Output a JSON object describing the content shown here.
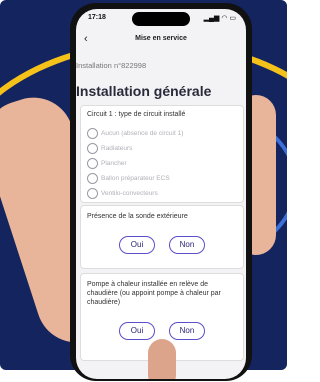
{
  "status_bar": {
    "time": "17:18"
  },
  "nav": {
    "back_icon": "chevron-left-icon",
    "title": "Mise en service"
  },
  "installation_number": "Installation n°822998",
  "page_title": "Installation générale",
  "circuit_card": {
    "title": "Circuit 1 : type de circuit installé",
    "options": [
      "Aucun (absence de circuit 1)",
      "Radiateurs",
      "Plancher",
      "Ballon préparateur ECS",
      "Ventilo-convecteurs"
    ]
  },
  "sensor_card": {
    "title": "Présence de la sonde extérieure",
    "yes_label": "Oui",
    "no_label": "Non"
  },
  "heatpump_card": {
    "title": "Pompe à chaleur installée en relève de chaudière (ou appoint pompe à chaleur par chaudière)",
    "yes_label": "Oui",
    "no_label": "Non"
  },
  "colors": {
    "background_blue": "#14245e",
    "accent_yellow": "#f5c21a",
    "button_border": "#5a4fc7"
  }
}
